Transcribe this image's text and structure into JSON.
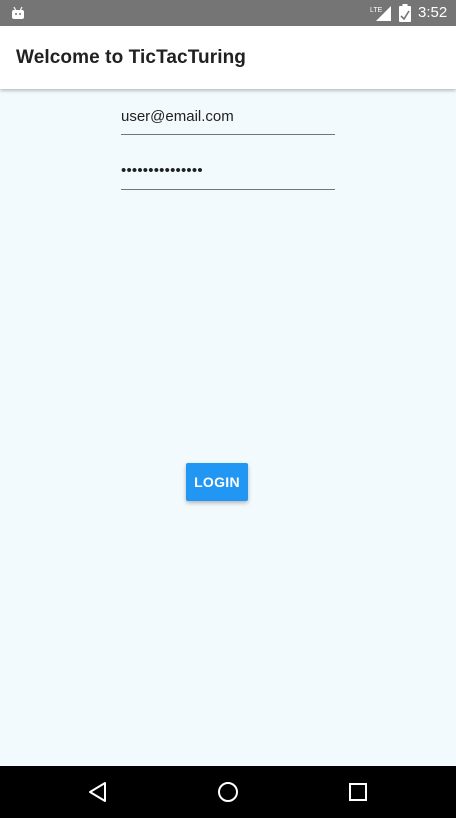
{
  "status_bar": {
    "app_icon": "android-debug-icon",
    "network": "LTE",
    "signal_icon": "cell-signal-icon",
    "battery_icon": "battery-icon",
    "time": "3:52"
  },
  "app_bar": {
    "title": "Welcome to TicTacTuring"
  },
  "login_form": {
    "email_value": "user@email.com",
    "password_value": "•••••••••••••••",
    "login_label": "LOGIN"
  },
  "nav_bar": {
    "back_icon": "back-triangle-icon",
    "home_icon": "home-circle-icon",
    "recents_icon": "recents-square-icon"
  },
  "colors": {
    "status_bar": "#757575",
    "app_bar": "#ffffff",
    "background": "#F3FAFD",
    "accent": "#2196F3",
    "nav_bar": "#000000"
  }
}
